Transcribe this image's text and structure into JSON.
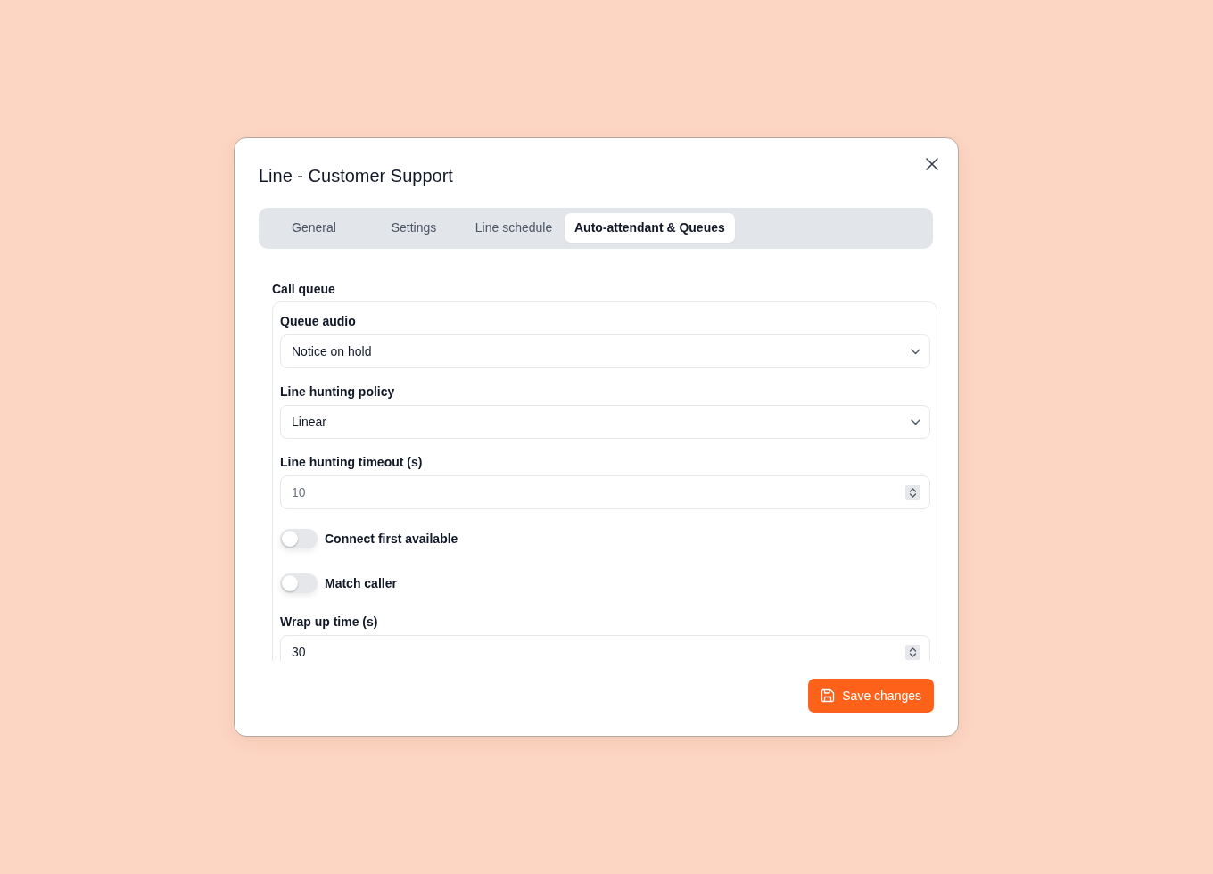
{
  "dialog": {
    "title": "Line - Customer Support"
  },
  "tabs": [
    {
      "label": "General",
      "selected": false
    },
    {
      "label": "Settings",
      "selected": false
    },
    {
      "label": "Line schedule",
      "selected": false
    },
    {
      "label": "Auto-attendant & Queues",
      "selected": true
    }
  ],
  "section": {
    "title": "Call queue",
    "fields": [
      {
        "kind": "select",
        "label": "Queue audio",
        "value": "Notice on hold"
      },
      {
        "kind": "select",
        "label": "Line hunting policy",
        "value": "Linear"
      },
      {
        "kind": "number",
        "label": "Line hunting timeout (s)",
        "placeholder": "10"
      },
      {
        "kind": "toggle",
        "label": "Connect first available",
        "on": false
      },
      {
        "kind": "toggle",
        "label": "Match caller",
        "on": false
      },
      {
        "kind": "number",
        "label": "Wrap up time (s)",
        "value": "30"
      }
    ]
  },
  "buttons": [
    {
      "label": "Save changes"
    }
  ]
}
